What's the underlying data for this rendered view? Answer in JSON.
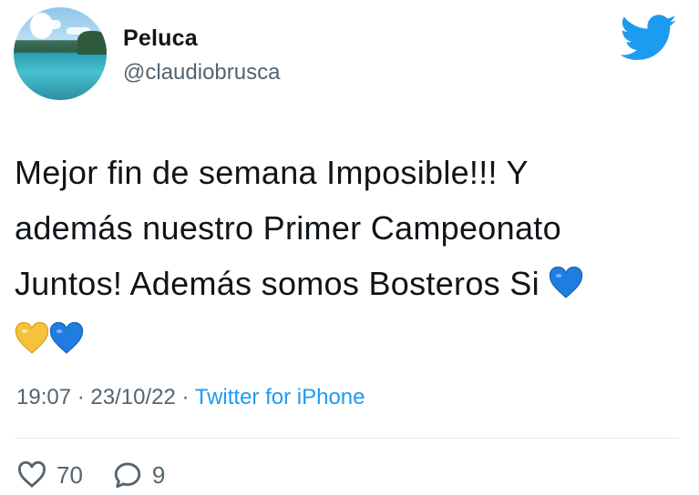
{
  "author": {
    "display_name": "Peluca",
    "handle": "@claudiobrusca"
  },
  "tweet": {
    "lines": [
      "Mejor fin de semana Imposible!!! Y",
      "además nuestro Primer Campeonato",
      "Juntos! Además somos Bosteros Si"
    ],
    "emojis": [
      "blue-heart",
      "yellow-heart",
      "blue-heart"
    ]
  },
  "meta": {
    "time": "19:07",
    "date": "23/10/22",
    "separator": "·",
    "source": "Twitter for iPhone"
  },
  "actions": {
    "likes": "70",
    "replies": "9"
  },
  "icons": [
    "twitter-bird-icon",
    "heart-icon",
    "reply-icon"
  ],
  "colors": {
    "twitter_blue": "#1d9bf0",
    "secondary_text": "#536471",
    "blue_heart": "#1f7de0",
    "yellow_heart": "#f5c33b"
  }
}
